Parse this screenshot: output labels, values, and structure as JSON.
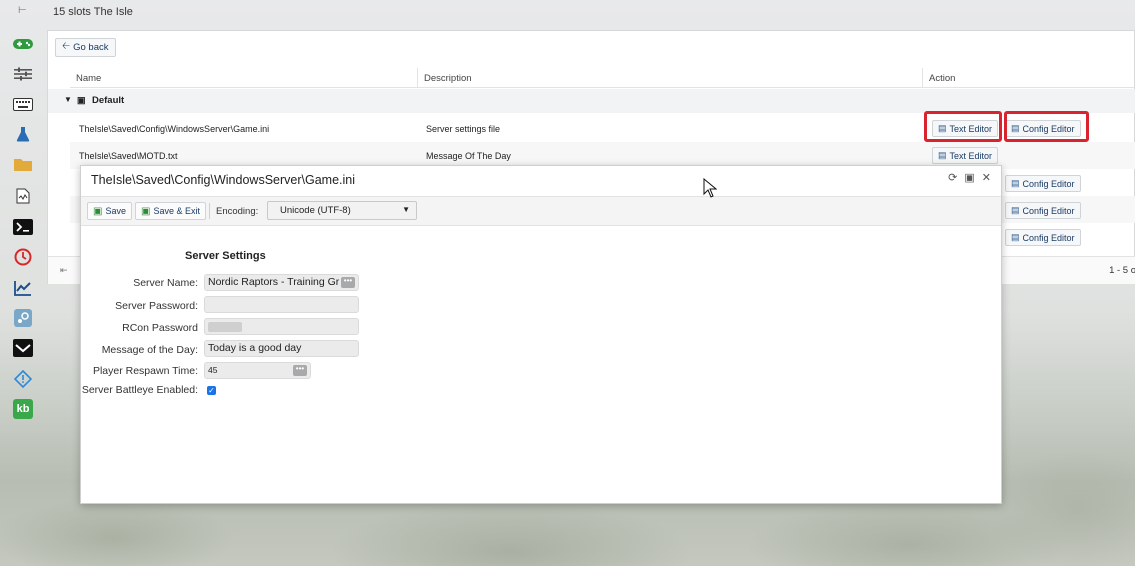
{
  "header": {
    "title": "15 slots The Isle"
  },
  "colors": {
    "accent": "#1a4f8a",
    "highlight": "#d8242e",
    "checkbox": "#1a73e8"
  },
  "sidebar": {
    "icons": [
      "gamepad-icon",
      "sliders-icon",
      "keyboard-icon",
      "flask-icon",
      "folder-icon",
      "file-activity-icon",
      "terminal-icon",
      "clock-icon",
      "chart-icon",
      "steam-icon",
      "steam-logo-icon",
      "alert-icon",
      "kb-icon"
    ],
    "kb_label": "kb"
  },
  "file_list": {
    "go_back": "Go back",
    "columns": {
      "name": "Name",
      "description": "Description",
      "action": "Action"
    },
    "group": "Default",
    "rows": [
      {
        "name": "TheIsle\\Saved\\Config\\WindowsServer\\Game.ini",
        "description": "Server settings file",
        "text_editor": "Text Editor",
        "config_editor": "Config Editor"
      },
      {
        "name": "TheIsle\\Saved\\MOTD.txt",
        "description": "Message Of The Day",
        "text_editor": "Text Editor"
      },
      {
        "config_editor": "Config Editor"
      },
      {
        "config_editor": "Config Editor"
      },
      {
        "config_editor": "Config Editor"
      }
    ],
    "pager_text": "1 - 5 o"
  },
  "dialog": {
    "title": "TheIsle\\Saved\\Config\\WindowsServer\\Game.ini",
    "toolbar": {
      "save": "Save",
      "save_exit": "Save & Exit",
      "encoding_label": "Encoding:",
      "encoding_value": "Unicode (UTF-8)"
    },
    "form": {
      "title": "Server Settings",
      "server_name_label": "Server Name:",
      "server_name_value": "Nordic Raptors - Training Gr",
      "server_password_label": "Server Password:",
      "server_password_value": "",
      "rcon_password_label": "RCon Password",
      "motd_label": "Message of the Day:",
      "motd_value": "Today is a good day",
      "respawn_label": "Player Respawn Time:",
      "respawn_value": "45",
      "battleye_label": "Server Battleye Enabled:",
      "battleye_checked": true
    }
  }
}
